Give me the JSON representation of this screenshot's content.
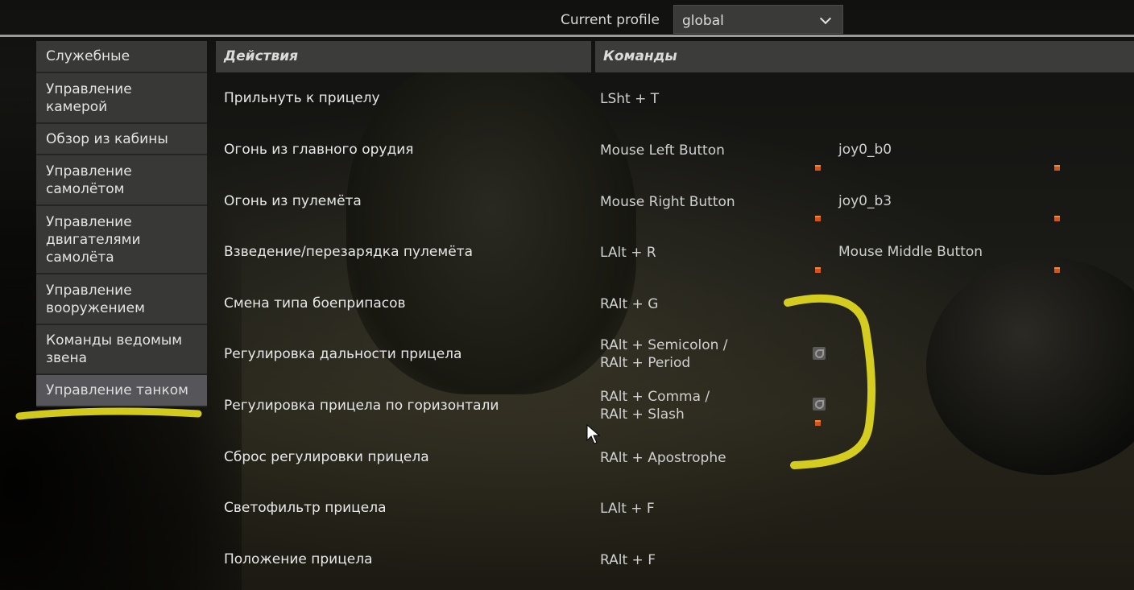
{
  "header": {
    "profile_label": "Current profile",
    "profile_value": "global"
  },
  "sidebar": {
    "items": [
      {
        "label": "Служебные"
      },
      {
        "label": "Управление камерой"
      },
      {
        "label": "Обзор из кабины"
      },
      {
        "label": "Управление самолётом"
      },
      {
        "label": "Управление двигателями самолёта"
      },
      {
        "label": "Управление вооружением"
      },
      {
        "label": "Команды ведомым звена"
      },
      {
        "label": "Управление танком"
      }
    ],
    "active_index": 7
  },
  "table": {
    "col_actions": "Действия",
    "col_commands": "Команды",
    "rows": [
      {
        "action": "Прильнуть к прицелу",
        "cmd1": "LSht + T",
        "cmd2": ""
      },
      {
        "action": "Огонь из главного орудия",
        "cmd1": "Mouse Left Button",
        "cmd2": "joy0_b0"
      },
      {
        "action": "Огонь из пулемёта",
        "cmd1": "Mouse Right Button",
        "cmd2": "joy0_b3"
      },
      {
        "action": "Взведение/перезарядка пулемёта",
        "cmd1": "LAlt + R",
        "cmd2": "Mouse Middle Button"
      },
      {
        "action": "Смена типа боеприпасов",
        "cmd1": "RAlt + G",
        "cmd2": ""
      },
      {
        "action": "Регулировка дальности прицела",
        "cmd1": "RAlt + Semicolon /\nRAlt + Period",
        "cmd2": ""
      },
      {
        "action": "Регулировка прицела по горизонтали",
        "cmd1": "RAlt + Comma /\nRAlt + Slash",
        "cmd2": ""
      },
      {
        "action": "Сброс регулировки прицела",
        "cmd1": "RAlt + Apostrophe",
        "cmd2": ""
      },
      {
        "action": "Светофильтр прицела",
        "cmd1": "LAlt + F",
        "cmd2": ""
      },
      {
        "action": "Положение прицела",
        "cmd1": "RAlt + F",
        "cmd2": ""
      }
    ]
  },
  "colors": {
    "accent_orange": "#d2551c",
    "highlight_yellow": "#e8e020",
    "panel_bg": "#383837"
  }
}
